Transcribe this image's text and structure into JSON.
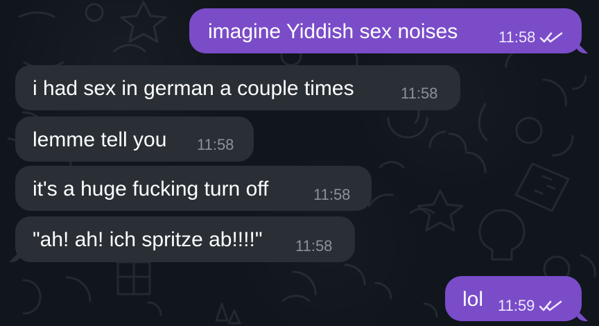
{
  "chat": {
    "messages": [
      {
        "text": "imagine Yiddish sex noises",
        "time": "11:58"
      },
      {
        "text": "i had sex in german a couple times",
        "time": "11:58"
      },
      {
        "text": "lemme tell you",
        "time": "11:58"
      },
      {
        "text": "it's a huge fucking turn off",
        "time": "11:58"
      },
      {
        "text": "\"ah! ah! ich spritze ab!!!!\"",
        "time": "11:58"
      },
      {
        "text": "lol",
        "time": "11:59"
      }
    ],
    "icons": {
      "read_receipt": "double-check-icon"
    },
    "colors": {
      "background": "#10161c",
      "incoming_bubble": "#2a2f36",
      "outgoing_bubble": "#7a4cc8",
      "incoming_time": "#8a929c",
      "outgoing_time": "#efe8ff"
    }
  }
}
